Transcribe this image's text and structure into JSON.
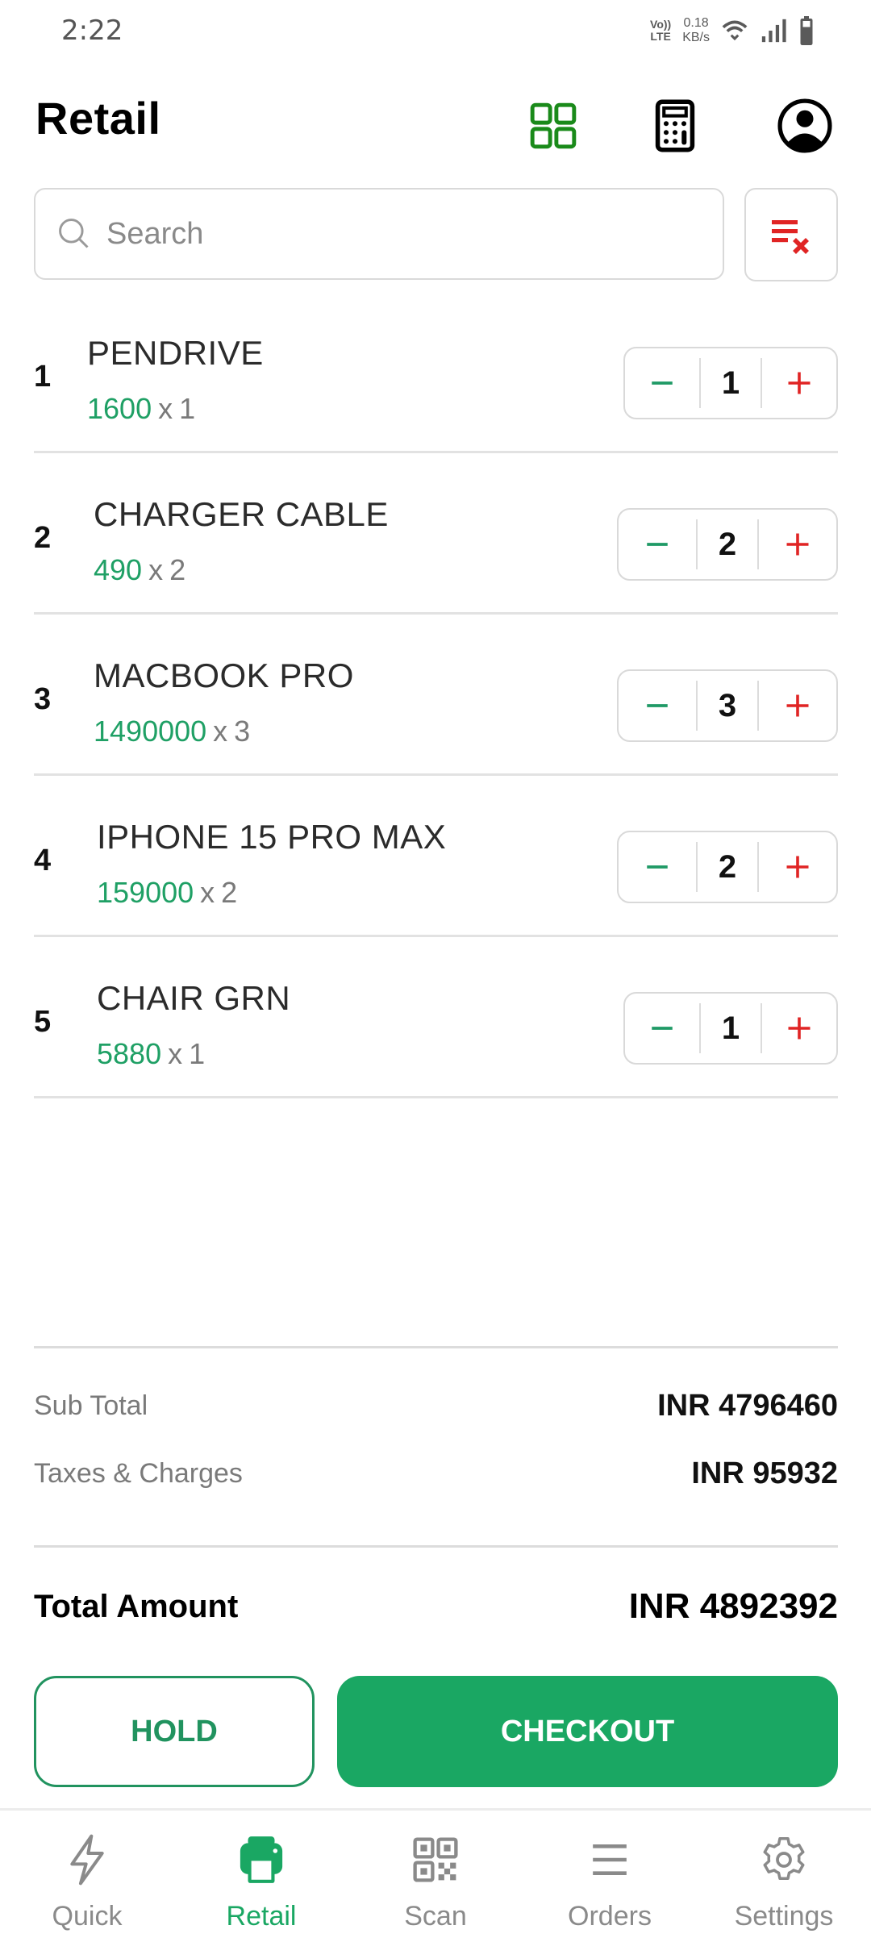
{
  "status_bar": {
    "time": "2:22",
    "volte_top": "Vo))",
    "volte_bottom": "LTE",
    "net_speed_value": "0.18",
    "net_speed_unit": "KB/s",
    "icons": [
      "volte-icon",
      "wifi-icon",
      "signal-icon",
      "battery-icon"
    ]
  },
  "header": {
    "title": "Retail",
    "icons": [
      "grid-view-icon",
      "calculator-icon",
      "account-icon"
    ]
  },
  "search": {
    "placeholder": "Search",
    "value": ""
  },
  "colors": {
    "brand_green": "#1aa763",
    "price_green": "#1fa065",
    "minus_green": "#1f9a66",
    "plus_red": "#e02424",
    "clear_red": "#e02424",
    "grid_icon_green": "#1a8a1a"
  },
  "cart": {
    "items": [
      {
        "index": "1",
        "name": "PENDRIVE",
        "price": "1600",
        "x": "x",
        "qty_label": "1",
        "qty": "1"
      },
      {
        "index": "2",
        "name": "CHARGER CABLE",
        "price": "490",
        "x": "x",
        "qty_label": "2",
        "qty": "2"
      },
      {
        "index": "3",
        "name": "MACBOOK PRO",
        "price": "1490000",
        "x": "x",
        "qty_label": "3",
        "qty": "3"
      },
      {
        "index": "4",
        "name": "IPHONE 15 PRO MAX",
        "price": "159000",
        "x": "x",
        "qty_label": "2",
        "qty": "2"
      },
      {
        "index": "5",
        "name": "CHAIR GRN",
        "price": "5880",
        "x": "x",
        "qty_label": "1",
        "qty": "1"
      }
    ]
  },
  "summary": {
    "subtotal_label": "Sub Total",
    "subtotal_value": "INR 4796460",
    "taxes_label": "Taxes & Charges",
    "taxes_value": "INR 95932",
    "total_label": "Total Amount",
    "total_value": "INR 4892392"
  },
  "actions": {
    "hold_label": "HOLD",
    "checkout_label": "CHECKOUT"
  },
  "bottom_nav": {
    "active": "Retail",
    "items": [
      {
        "label": "Quick",
        "icon": "lightning-icon"
      },
      {
        "label": "Retail",
        "icon": "printer-icon"
      },
      {
        "label": "Scan",
        "icon": "qr-code-icon"
      },
      {
        "label": "Orders",
        "icon": "list-icon"
      },
      {
        "label": "Settings",
        "icon": "gear-icon"
      }
    ]
  }
}
